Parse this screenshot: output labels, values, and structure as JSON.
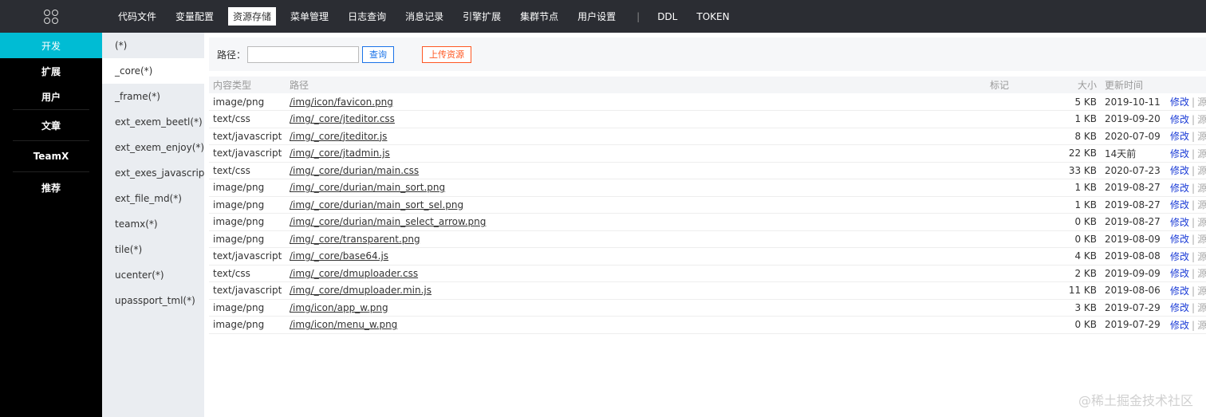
{
  "sidebar": {
    "logo_icon": "grid-circles-icon",
    "items": [
      {
        "label": "开发"
      },
      {
        "label": "扩展"
      },
      {
        "label": "用户"
      },
      {
        "label": "文章"
      },
      {
        "label": "TeamX"
      },
      {
        "label": "推荐"
      }
    ]
  },
  "topnav": {
    "tabs": [
      {
        "label": "代码文件"
      },
      {
        "label": "变量配置"
      },
      {
        "label": "资源存储"
      },
      {
        "label": "菜单管理"
      },
      {
        "label": "日志查询"
      },
      {
        "label": "消息记录"
      },
      {
        "label": "引擎扩展"
      },
      {
        "label": "集群节点"
      },
      {
        "label": "用户设置"
      }
    ],
    "divider": "|",
    "extra_tabs": [
      {
        "label": "DDL"
      },
      {
        "label": "TOKEN"
      }
    ]
  },
  "subnav": {
    "items": [
      {
        "label": "(*)"
      },
      {
        "label": "_core(*)"
      },
      {
        "label": "_frame(*)"
      },
      {
        "label": "ext_exem_beetl(*)"
      },
      {
        "label": "ext_exem_enjoy(*)"
      },
      {
        "label": "ext_exes_javascript(*)"
      },
      {
        "label": "ext_file_md(*)"
      },
      {
        "label": "teamx(*)"
      },
      {
        "label": "tile(*)"
      },
      {
        "label": "ucenter(*)"
      },
      {
        "label": "upassport_tml(*)"
      }
    ]
  },
  "toolbar": {
    "path_label": "路径：",
    "path_value": "",
    "query_label": "查询",
    "upload_label": "上传资源"
  },
  "table": {
    "headers": {
      "type": "内容类型",
      "path": "路径",
      "tag": "标记",
      "size": "大小",
      "time": "更新时间"
    },
    "edit_label": "修改",
    "sep": "|",
    "src_label": "源",
    "rows": [
      {
        "type": "image/png",
        "path": "/img/icon/favicon.png",
        "size": "5 KB",
        "time": "2019-10-11"
      },
      {
        "type": "text/css",
        "path": "/img/_core/jteditor.css",
        "size": "1 KB",
        "time": "2019-09-20"
      },
      {
        "type": "text/javascript",
        "path": "/img/_core/jteditor.js",
        "size": "8 KB",
        "time": "2020-07-09"
      },
      {
        "type": "text/javascript",
        "path": "/img/_core/jtadmin.js",
        "size": "22 KB",
        "time": "14天前"
      },
      {
        "type": "text/css",
        "path": "/img/_core/durian/main.css",
        "size": "33 KB",
        "time": "2020-07-23"
      },
      {
        "type": "image/png",
        "path": "/img/_core/durian/main_sort.png",
        "size": "1 KB",
        "time": "2019-08-27"
      },
      {
        "type": "image/png",
        "path": "/img/_core/durian/main_sort_sel.png",
        "size": "1 KB",
        "time": "2019-08-27"
      },
      {
        "type": "image/png",
        "path": "/img/_core/durian/main_select_arrow.png",
        "size": "0 KB",
        "time": "2019-08-27"
      },
      {
        "type": "image/png",
        "path": "/img/_core/transparent.png",
        "size": "0 KB",
        "time": "2019-08-09"
      },
      {
        "type": "text/javascript",
        "path": "/img/_core/base64.js",
        "size": "4 KB",
        "time": "2019-08-08"
      },
      {
        "type": "text/css",
        "path": "/img/_core/dmuploader.css",
        "size": "2 KB",
        "time": "2019-09-09"
      },
      {
        "type": "text/javascript",
        "path": "/img/_core/dmuploader.min.js",
        "size": "11 KB",
        "time": "2019-08-06"
      },
      {
        "type": "image/png",
        "path": "/img/icon/app_w.png",
        "size": "3 KB",
        "time": "2019-07-29"
      },
      {
        "type": "image/png",
        "path": "/img/icon/menu_w.png",
        "size": "0 KB",
        "time": "2019-07-29"
      }
    ]
  },
  "watermark": "@稀土掘金技术社区",
  "colors": {
    "accent": "#00bcd4",
    "topbar": "#2b2d33",
    "edit_link": "#1a3bd6",
    "upload_btn": "#ff5722",
    "query_btn": "#1a73e8"
  }
}
